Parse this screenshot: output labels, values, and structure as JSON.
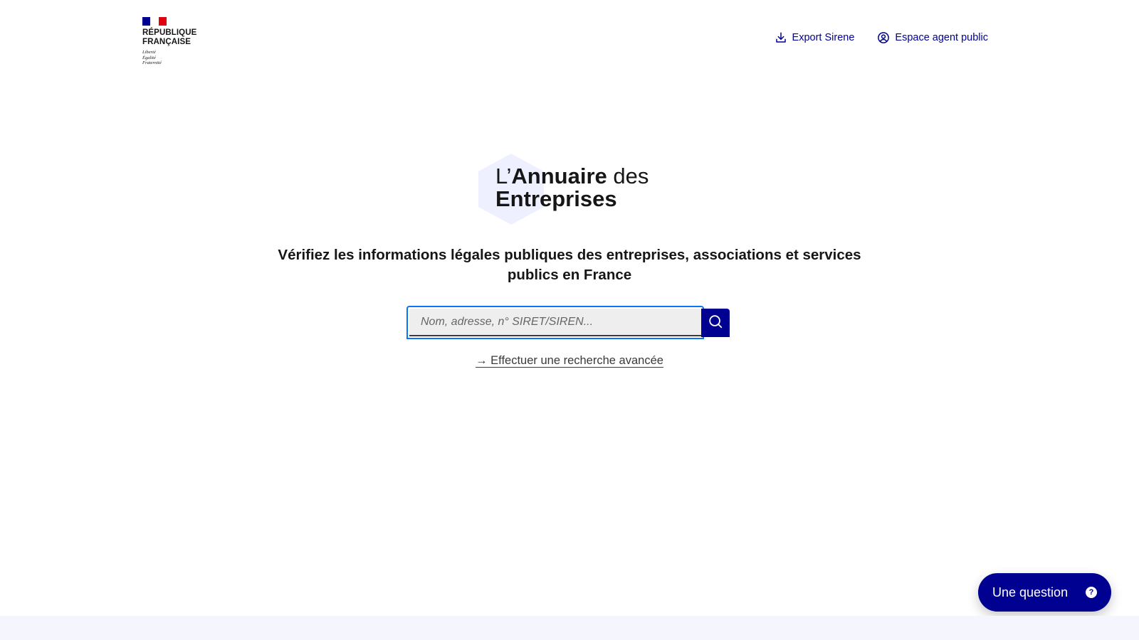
{
  "colors": {
    "brand_blue": "#000091",
    "focus_blue": "#0a76f6",
    "flag_red": "#e1000f",
    "footer_band": "#f5f5fe",
    "logo_hexagon": "#eef0ff"
  },
  "header": {
    "gov_name_line1": "République",
    "gov_name_line2": "Française",
    "motto_line1": "Liberté",
    "motto_line2": "Égalité",
    "motto_line3": "Fraternité",
    "links": [
      {
        "label": "Export Sirene",
        "icon": "download-icon"
      },
      {
        "label": "Espace agent public",
        "icon": "user-circle-icon"
      }
    ]
  },
  "hero": {
    "logo_prefix": "L’",
    "logo_bold1": "Annuaire",
    "logo_suffix": "des",
    "logo_bold2": "Entreprises",
    "tagline_line1": "Vérifiez les informations légales publiques des entreprises, associations et services",
    "tagline_line2": "publics en France"
  },
  "search": {
    "placeholder": "Nom, adresse, n° SIRET/SIREN...",
    "value": "",
    "button_icon": "search-icon",
    "advanced_link": "→ Effectuer une recherche avancée"
  },
  "help": {
    "label": "Une question",
    "icon": "question-icon",
    "icon_glyph": "?"
  }
}
